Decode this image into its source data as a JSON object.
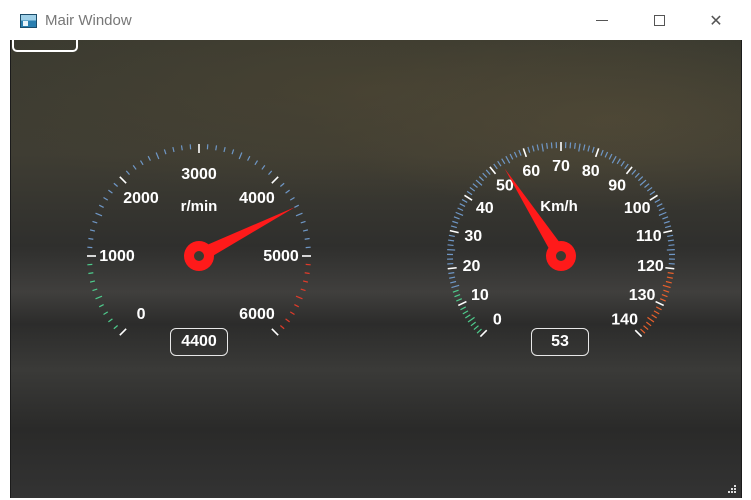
{
  "window": {
    "title": "Mair Window"
  },
  "rpm_gauge": {
    "labels": [
      "0",
      "1000",
      "2000",
      "3000",
      "4000",
      "5000",
      "6000"
    ],
    "unit": "r/min",
    "value": 4400,
    "readout": "4400",
    "min": 0,
    "max": 6000,
    "colors": {
      "normal": "#6f97c6",
      "low": "#4ecb8c",
      "redline": "#e03b2a",
      "needle": "#ff1a1a"
    }
  },
  "speed_gauge": {
    "labels": [
      "0",
      "10",
      "20",
      "30",
      "40",
      "50",
      "60",
      "70",
      "80",
      "90",
      "100",
      "110",
      "120",
      "130",
      "140"
    ],
    "unit": "Km/h",
    "value": 53,
    "readout": "53",
    "min": 0,
    "max": 140,
    "colors": {
      "normal": "#6f97c6",
      "low": "#4ecb8c",
      "high": "#e8602c",
      "needle": "#ff1a1a"
    }
  }
}
